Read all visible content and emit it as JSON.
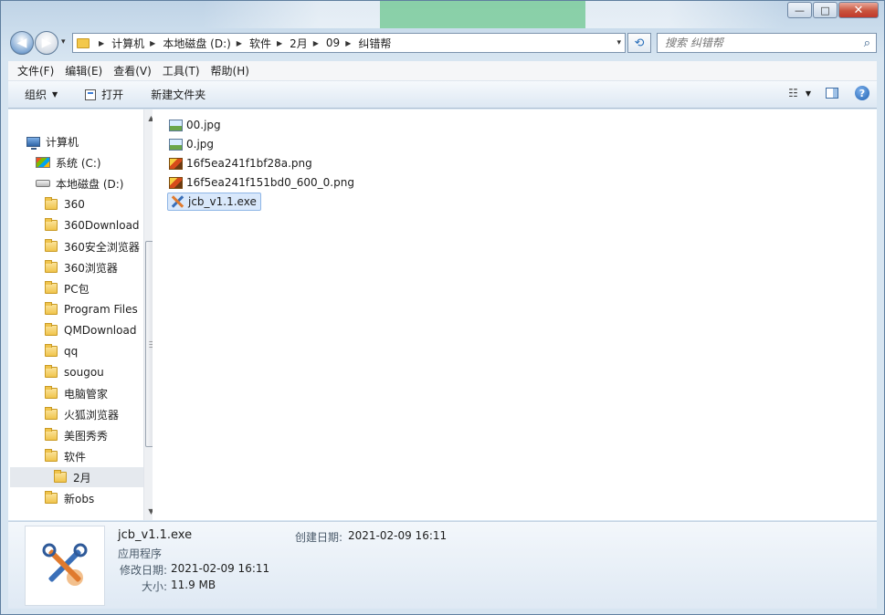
{
  "window": {
    "caption": {
      "minimize": "—",
      "maximize": "□",
      "close": "✕"
    }
  },
  "nav": {
    "back_icon": "◀",
    "forward_icon": "▶",
    "dropdown_icon": "▾",
    "refresh_icon": "⟲",
    "breadcrumb": [
      "计算机",
      "本地磁盘 (D:)",
      "软件",
      "2月",
      "09",
      "纠错帮"
    ]
  },
  "search": {
    "placeholder": "搜索 纠错帮",
    "icon": "magnifier-icon"
  },
  "menubar": [
    "文件(F)",
    "编辑(E)",
    "查看(V)",
    "工具(T)",
    "帮助(H)"
  ],
  "toolbar": {
    "organize": "组织",
    "open": "打开",
    "new_folder": "新建文件夹",
    "help": "?"
  },
  "tree": {
    "computer": "计算机",
    "drive_c": "系统 (C:)",
    "drive_d": "本地磁盘 (D:)",
    "folders": [
      "360",
      "360Download",
      "360安全浏览器",
      "360浏览器",
      "PC包",
      "Program Files",
      "QMDownload",
      "qq",
      "sougou",
      "电脑管家",
      "火狐浏览器",
      "美图秀秀",
      "软件"
    ],
    "subfolder": "2月",
    "after": [
      "新obs"
    ]
  },
  "files": [
    {
      "name": "00.jpg",
      "type": "jpg"
    },
    {
      "name": "0.jpg",
      "type": "jpg"
    },
    {
      "name": "16f5ea241f1bf28a.png",
      "type": "png"
    },
    {
      "name": "16f5ea241f151bd0_600_0.png",
      "type": "png"
    },
    {
      "name": "jcb_v1.1.exe",
      "type": "exe",
      "selected": true
    }
  ],
  "details": {
    "name": "jcb_v1.1.exe",
    "type": "应用程序",
    "modified_label": "修改日期:",
    "modified": "2021-02-09 16:11",
    "size_label": "大小:",
    "size": "11.9 MB",
    "created_label": "创建日期:",
    "created": "2021-02-09 16:11"
  }
}
